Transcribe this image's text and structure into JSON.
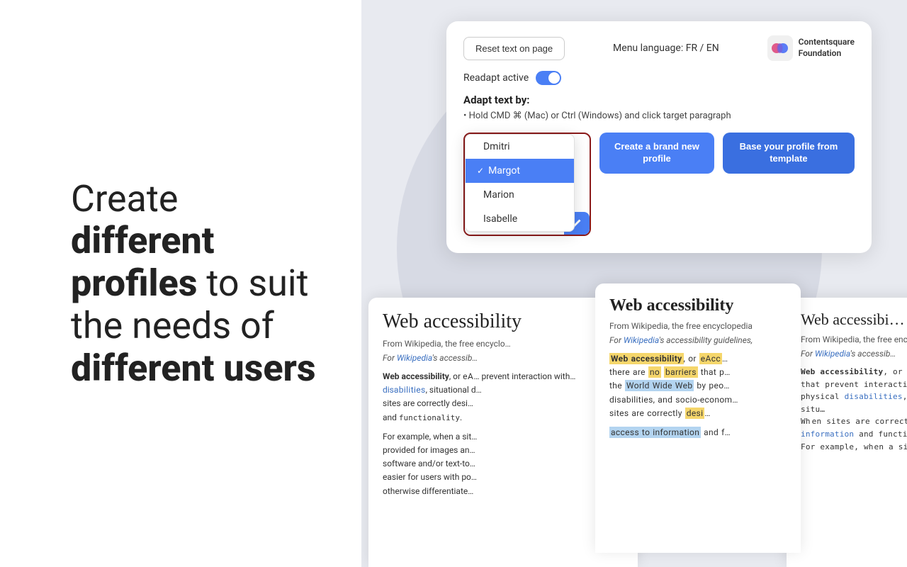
{
  "left": {
    "headline_plain": "Create ",
    "headline_bold1": "different profiles",
    "headline_mid": " to suit the needs of ",
    "headline_bold2": "different users"
  },
  "toolbar": {
    "reset_btn": "Reset text on page",
    "menu_language": "Menu language: FR / EN",
    "logo_name1": "Contentsquare",
    "logo_name2": "Foundation",
    "readapt_label": "Readapt active",
    "adapt_title": "Adapt text by:",
    "adapt_hint": "Hold CMD ⌘ (Mac) or Ctrl (Windows) and click target paragraph",
    "dropdown_selected": "Margot",
    "dropdown_items": [
      {
        "name": "Dmitri",
        "selected": false
      },
      {
        "name": "Margot",
        "selected": true
      },
      {
        "name": "Marion",
        "selected": false
      },
      {
        "name": "Isabelle",
        "selected": false
      }
    ],
    "btn_new_profile": "Create a brand new profile",
    "btn_template": "Base your profile from template"
  },
  "wiki": {
    "title": "Web accessibility",
    "from": "From Wikipedia, the free encyclo…",
    "italic_prefix": "For ",
    "italic_link": "Wikipedia",
    "italic_suffix": "'s accessib…",
    "body1": "Web accessibility, or eA… prevent interaction with… disabilities, situational d… sites are correctly desi… and functionality.",
    "body2": "For example, when a sit… provided for images an… software and/or text-to… easier for users with po… otherwise differentiate…"
  },
  "wiki_highlight": {
    "title": "Web accessibility",
    "from": "From Wikipedia, the free encyclopedia",
    "italic_prefix": "For ",
    "italic_link": "Wikipedia",
    "italic_suffix": "'s accessibility guidelines,",
    "body_intro": "accessibility",
    "body_text": ", or eAcc… there are no barriers that p… the ",
    "world_wide_web": "World Wide Web",
    "body_cont": " by peo… disabilities, and socio-econom… sites are correctly desi…",
    "body_access": "access to information",
    "body_end": " and f…"
  },
  "wiki_right": {
    "title": "Web accessibi…",
    "from": "From Wikipedia, the free encyc…",
    "italic": "For Wikipedia's accessib…",
    "body1": "Web accessibility, or e…",
    "body2": "that prevent interaction…",
    "body3": "physical disabilities, situ…",
    "body4": "W hen sites are correctly…",
    "body5": "information and functi…",
    "body6": "For example, w hen a sit…"
  }
}
